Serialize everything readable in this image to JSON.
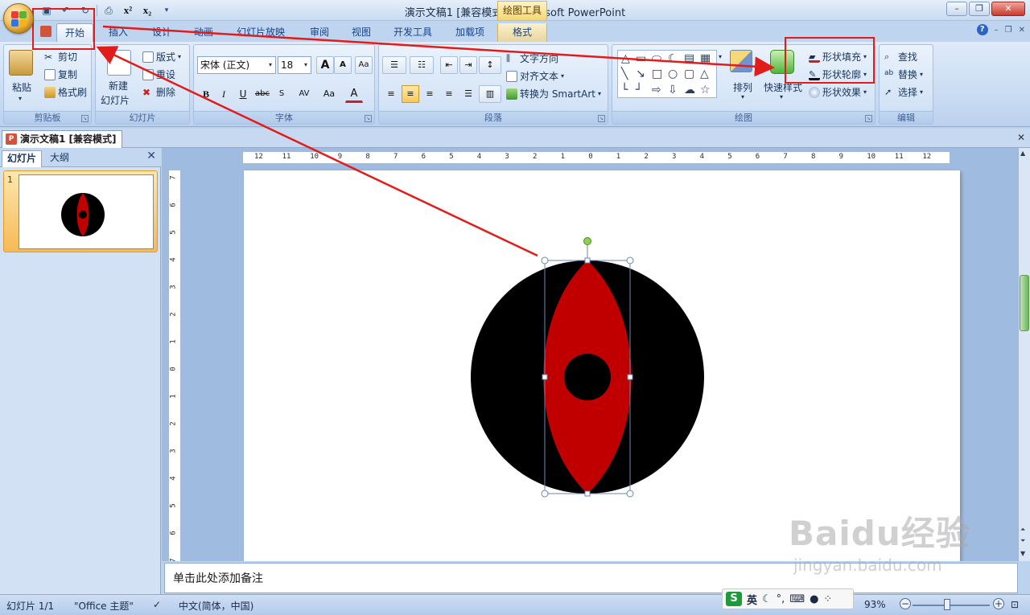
{
  "window": {
    "title": "演示文稿1 [兼容模式] - Microsoft PowerPoint",
    "contextual_tab_group": "绘图工具"
  },
  "tabs": [
    "开始",
    "插入",
    "设计",
    "动画",
    "幻灯片放映",
    "审阅",
    "视图",
    "开发工具",
    "加载项",
    "格式"
  ],
  "active_tab": "开始",
  "ribbon": {
    "clipboard": {
      "label": "剪贴板",
      "paste": "粘贴",
      "cut": "剪切",
      "copy": "复制",
      "format_painter": "格式刷"
    },
    "slides": {
      "label": "幻灯片",
      "new_slide_line1": "新建",
      "new_slide_line2": "幻灯片",
      "layout": "版式",
      "reset": "重设",
      "delete": "删除"
    },
    "font": {
      "label": "字体",
      "font_name": "宋体 (正文)",
      "font_size": "18",
      "bold": "B",
      "italic": "I",
      "underline": "U",
      "strike": "abc",
      "spacing": "AV",
      "case": "Aa",
      "color": "A",
      "grow": "A",
      "shrink": "A"
    },
    "paragraph": {
      "label": "段落",
      "text_direction": "文字方向",
      "align_text": "对齐文本",
      "smartart": "转换为 SmartArt"
    },
    "drawing": {
      "label": "绘图",
      "arrange": "排列",
      "quick_styles": "快速样式",
      "shape_fill": "形状填充",
      "shape_outline": "形状轮廓",
      "shape_effects": "形状效果"
    },
    "editing": {
      "label": "编辑",
      "find": "查找",
      "replace": "替换",
      "select": "选择"
    }
  },
  "document_tab": "演示文稿1 [兼容模式]",
  "slides_pane": {
    "tab_slides": "幻灯片",
    "tab_outline": "大纲",
    "slide_number": "1"
  },
  "ruler": {
    "h_labels": [
      "12",
      "11",
      "10",
      "9",
      "8",
      "7",
      "6",
      "5",
      "4",
      "3",
      "2",
      "1",
      "0",
      "1",
      "2",
      "3",
      "4",
      "5",
      "6",
      "7",
      "8",
      "9",
      "10",
      "11",
      "12"
    ],
    "v_labels": [
      "7",
      "6",
      "5",
      "4",
      "3",
      "2",
      "1",
      "0",
      "1",
      "2",
      "3",
      "4",
      "5",
      "6",
      "7"
    ]
  },
  "notes_placeholder": "单击此处添加备注",
  "status": {
    "slide_count": "幻灯片 1/1",
    "theme": "\"Office 主题\"",
    "language": "中文(简体，中国)",
    "zoom": "93%"
  },
  "ime": {
    "mode": "英",
    "logo": "S"
  },
  "watermark": {
    "brand": "Baidu经验",
    "url": "jingyan.baidu.com"
  },
  "colors": {
    "accent_red": "#c00000",
    "annotation_red": "#e21b1b",
    "ribbon_blue": "#15428b"
  },
  "annotation": {
    "from_tab": "开始",
    "to_group": "形状填充 / 形状轮廓",
    "target": "selected shape"
  }
}
